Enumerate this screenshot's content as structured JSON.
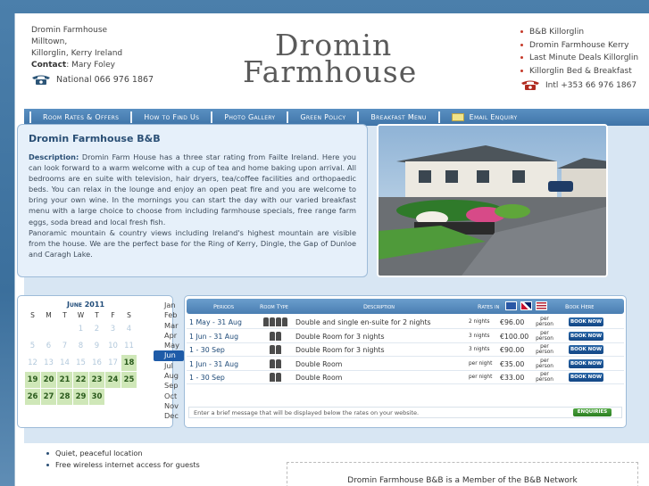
{
  "header": {
    "address_lines": [
      "Dromin Farmhouse",
      "Milltown,",
      "Killorglin, Kerry Ireland"
    ],
    "contact_label": "Contact",
    "contact_name": ": Mary Foley",
    "phone_national": "National 066 976 1867",
    "logo_line1": "Dromin",
    "logo_line2": "Farmhouse",
    "links": [
      "B&B Killorglin",
      "Dromin Farmhouse Kerry",
      "Last Minute Deals Killorglin",
      "Killorglin Bed & Breakfast"
    ],
    "phone_intl": "Intl +353 66 976 1867"
  },
  "nav": [
    "Room Rates & Offers",
    "How to Find Us",
    "Photo Gallery",
    "Green Policy",
    "Breakfast Menu",
    "Email Enquiry"
  ],
  "description": {
    "title": "Dromin Farmhouse B&B",
    "label": "Description:",
    "text": " Dromin Farm House has a three star rating from Failte Ireland. Here you can look forward to a warm welcome with a cup of tea and home baking upon arrival. All bedrooms are en suite with television, hair dryers, tea/coffee facilities and orthopaedic beds. You can relax in the lounge and enjoy an open peat fire and you are welcome to bring your own wine. In the mornings you can start the day with our varied breakfast menu with a large choice to choose from including farmhouse specials, free range farm eggs, soda bread and local fresh fish.",
    "text2": "Panoramic mountain & country views including Ireland's highest mountain are visible from the house. We are the perfect base for the Ring of Kerry, Dingle, the Gap of Dunloe and Caragh Lake."
  },
  "calendar": {
    "title": "June 2011",
    "dow": [
      "S",
      "M",
      "T",
      "W",
      "T",
      "F",
      "S"
    ],
    "weeks": [
      [
        "",
        "",
        "",
        "1",
        "2",
        "3",
        "4"
      ],
      [
        "5",
        "6",
        "7",
        "8",
        "9",
        "10",
        "11"
      ],
      [
        "12",
        "13",
        "14",
        "15",
        "16",
        "17",
        "18"
      ],
      [
        "19",
        "20",
        "21",
        "22",
        "23",
        "24",
        "25"
      ],
      [
        "26",
        "27",
        "28",
        "29",
        "30",
        "",
        ""
      ]
    ],
    "available_from": 18,
    "months": [
      "Jan",
      "Feb",
      "Mar",
      "Apr",
      "May",
      "Jun",
      "Jul",
      "Aug",
      "Sep",
      "Oct",
      "Nov",
      "Dec"
    ],
    "selected_month": "Jun"
  },
  "rates": {
    "headers": [
      "Periods",
      "Room Type",
      "Description",
      "Rates in",
      "Book Here"
    ],
    "rows": [
      {
        "period": "1 May - 31 Aug",
        "guests": 4,
        "description": "Double and single en-suite for 2 nights",
        "unit": "2 nights",
        "price": "€96.00",
        "per": "per person",
        "book": "BOOK NOW"
      },
      {
        "period": "1 Jun - 31 Aug",
        "guests": 2,
        "description": "Double Room for 3 nights",
        "unit": "3 nights",
        "price": "€100.00",
        "per": "per person",
        "book": "BOOK NOW"
      },
      {
        "period": "1 - 30 Sep",
        "guests": 2,
        "description": "Double Room for 3 nights",
        "unit": "3 nights",
        "price": "€90.00",
        "per": "per person",
        "book": "BOOK NOW"
      },
      {
        "period": "1 Jun - 31 Aug",
        "guests": 2,
        "description": "Double Room",
        "unit": "per night",
        "price": "€35.00",
        "per": "per person",
        "book": "BOOK NOW"
      },
      {
        "period": "1 - 30 Sep",
        "guests": 2,
        "description": "Double Room",
        "unit": "per night",
        "price": "€33.00",
        "per": "per person",
        "book": "BOOK NOW"
      }
    ],
    "message": "Enter a brief message that will be displayed below the rates on your website.",
    "enquiries": "ENQUIRIES"
  },
  "features": [
    "Quiet, peaceful location",
    "Free wireless internet access for guests"
  ],
  "member_text": "Dromin Farmhouse B&B is a Member of the B&B Network"
}
